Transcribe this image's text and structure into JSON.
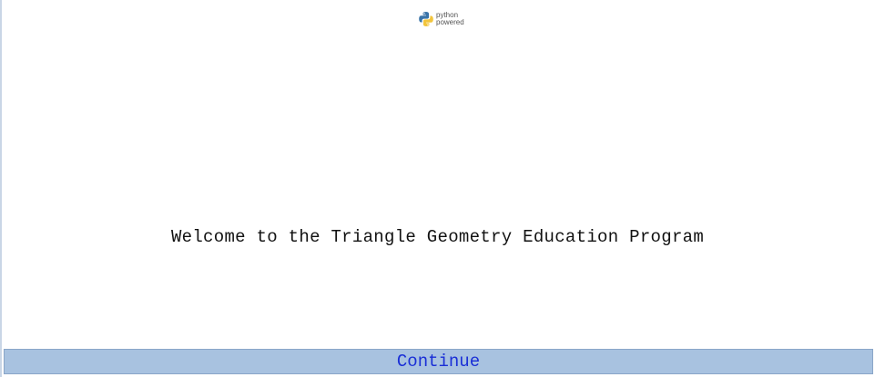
{
  "logo": {
    "icon": "python-logo-icon",
    "line1": "python",
    "line2": "powered"
  },
  "welcome": {
    "text": "Welcome to the Triangle Geometry Education Program"
  },
  "continue_button": {
    "label": "Continue"
  },
  "colors": {
    "button_background": "#a8c2e0",
    "button_text": "#1a2fd6",
    "python_blue": "#3a74a8",
    "python_yellow": "#f2c53d"
  }
}
